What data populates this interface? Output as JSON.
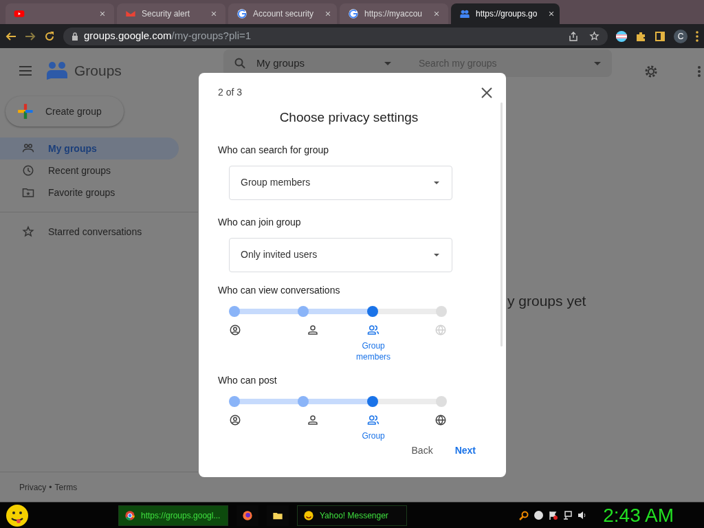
{
  "browser": {
    "tabs": [
      {
        "kind": "youtube",
        "selected": false
      },
      {
        "kind": "gmail",
        "title": "Security alert",
        "selected": false
      },
      {
        "kind": "google",
        "title": "Account security",
        "selected": false
      },
      {
        "kind": "google",
        "title": "https://myaccou",
        "selected": false
      },
      {
        "kind": "groups",
        "title": "https://groups.go",
        "selected": true
      }
    ],
    "address": {
      "host": "groups.google.com",
      "path": "/my-groups?pli=1"
    },
    "profile": "C"
  },
  "app": {
    "title": "Groups",
    "create_button": "Create group",
    "nav": [
      {
        "kind": "groups",
        "label": "My groups",
        "selected": true
      },
      {
        "kind": "clock",
        "label": "Recent groups",
        "selected": false
      },
      {
        "kind": "folder",
        "label": "Favorite groups",
        "selected": false
      },
      {
        "kind": "star",
        "label": "Starred conversations",
        "selected": false
      }
    ],
    "footer": {
      "links": [
        "Privacy",
        "Terms"
      ],
      "separator": "•"
    },
    "search": {
      "scope": "My groups",
      "placeholder": "Search my groups"
    },
    "empty_text": "y groups yet"
  },
  "dialog": {
    "step": "2 of 3",
    "title": "Choose privacy settings",
    "dropdowns": [
      {
        "label": "Who can search for group",
        "value": "Group members"
      },
      {
        "label": "Who can join group",
        "value": "Only invited users"
      }
    ],
    "sliders": [
      {
        "label": "Who can view conversations",
        "level": 0.667,
        "selected_label": "Group members",
        "stops": [
          {
            "kind": "owner",
            "disabled": false
          },
          {
            "kind": "manager",
            "disabled": false
          },
          {
            "kind": "members",
            "disabled": false
          },
          {
            "kind": "web",
            "disabled": true
          }
        ]
      },
      {
        "label": "Who can post",
        "level": 0.667,
        "selected_label": "Group",
        "stops": [
          {
            "kind": "owner",
            "disabled": false
          },
          {
            "kind": "manager",
            "disabled": false
          },
          {
            "kind": "members",
            "disabled": false
          },
          {
            "kind": "web",
            "disabled": false
          }
        ]
      }
    ],
    "buttons": [
      {
        "label": "Back",
        "primary": false
      },
      {
        "label": "Next",
        "primary": true
      }
    ]
  },
  "taskbar": {
    "items": [
      {
        "kind": "chrome",
        "label": "https://groups.googl...",
        "selected": true
      },
      {
        "kind": "firefox",
        "selected": false
      },
      {
        "kind": "folder",
        "selected": false
      },
      {
        "kind": "yahoo",
        "label": "Yahoo! Messenger",
        "selected": false
      }
    ],
    "clock": "2:43 AM"
  }
}
